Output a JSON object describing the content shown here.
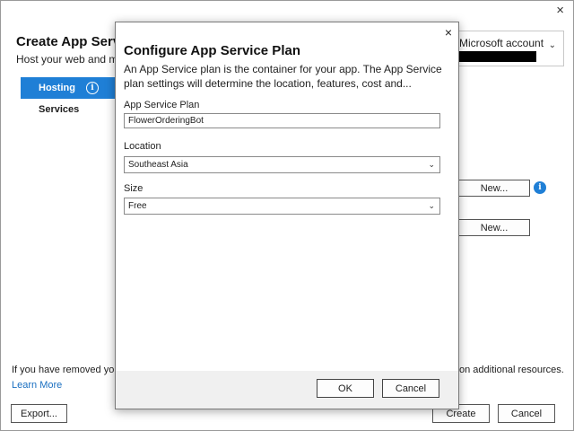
{
  "background": {
    "title": "Create App Serv",
    "subtitle": "Host your web and m",
    "nav": {
      "hosting_label": "Hosting",
      "services_label": "Services"
    },
    "account": {
      "label": "Microsoft account",
      "chevron": "⌄"
    },
    "new_button_1": "New...",
    "new_button_2": "New...",
    "footer_note_left": "If you have removed your s",
    "footer_note_right": "on additional resources.",
    "learn_more": "Learn More",
    "export_button": "Export...",
    "create_button": "Create",
    "cancel_button": "Cancel",
    "close_glyph": "×"
  },
  "dialog": {
    "title": "Configure App Service Plan",
    "description": "An App Service plan is the container for your app. The App Service plan settings will determine the location, features, cost and...",
    "close_glyph": "×",
    "fields": {
      "plan_label": "App Service Plan",
      "plan_value": "FlowerOrderingBot",
      "location_label": "Location",
      "location_value": "Southeast Asia",
      "size_label": "Size",
      "size_value": "Free"
    },
    "ok_button": "OK",
    "cancel_button": "Cancel"
  },
  "colors": {
    "accent": "#1f7fd6",
    "link": "#1a6fc1",
    "footer_bg": "#f0f0f0"
  },
  "icons": {
    "info": "info-icon",
    "chevron": "chevron-down-icon",
    "close": "close-icon"
  }
}
